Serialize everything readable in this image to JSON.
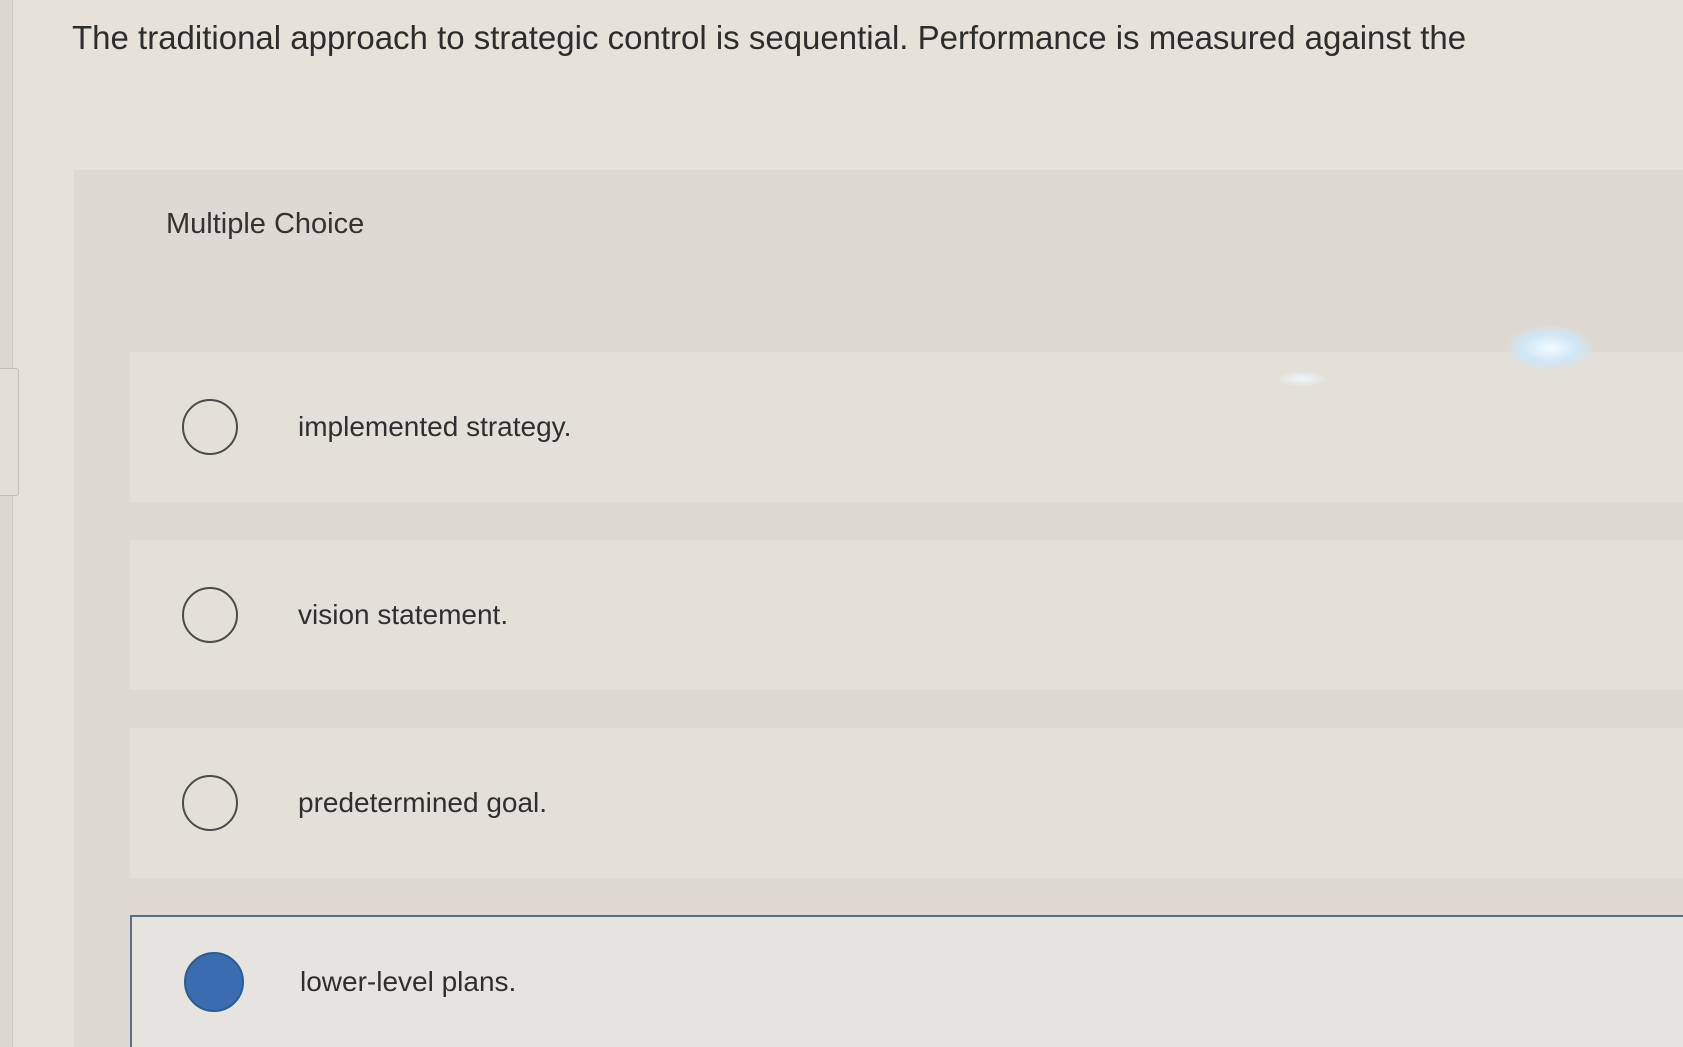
{
  "question": {
    "text": "The traditional approach to strategic control is sequential. Performance is measured against the"
  },
  "panel": {
    "label": "Multiple Choice"
  },
  "options": [
    {
      "text": "implemented strategy.",
      "selected": false
    },
    {
      "text": "vision statement.",
      "selected": false
    },
    {
      "text": "predetermined goal.",
      "selected": false
    },
    {
      "text": "lower-level plans.",
      "selected": true
    }
  ],
  "colors": {
    "selected_radio": "#3a6cb0",
    "selected_border": "#5e6e82",
    "background": "#e6e2da"
  }
}
